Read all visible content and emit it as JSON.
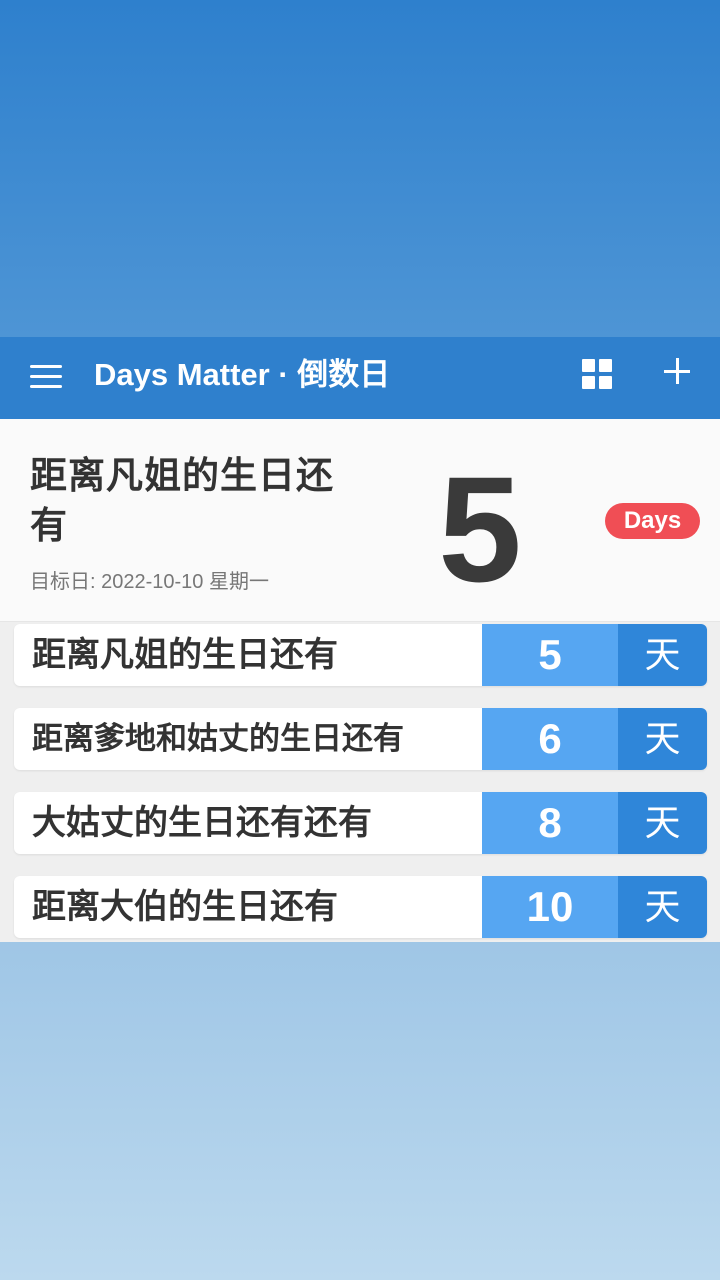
{
  "app": {
    "title": "Days Matter · 倒数日"
  },
  "toolbar": {
    "menu_icon": "menu-icon",
    "grid_icon": "grid-icon",
    "add_icon": "plus-icon"
  },
  "hero": {
    "title": "距离凡姐的生日还有",
    "target_date": "目标日: 2022-10-10 星期一",
    "days": "5",
    "badge": "Days"
  },
  "events": [
    {
      "title": "距离凡姐的生日还有",
      "count": "5",
      "unit": "天"
    },
    {
      "title": "距离爹地和姑丈的生日还有",
      "count": "6",
      "unit": "天"
    },
    {
      "title": "大姑丈的生日还有还有",
      "count": "8",
      "unit": "天"
    },
    {
      "title": "距离大伯的生日还有",
      "count": "10",
      "unit": "天"
    }
  ],
  "colors": {
    "toolbar": "#2f80cd",
    "count_cell": "#56a6f2",
    "unit_cell": "#2f86d9",
    "badge": "#f04e55"
  }
}
